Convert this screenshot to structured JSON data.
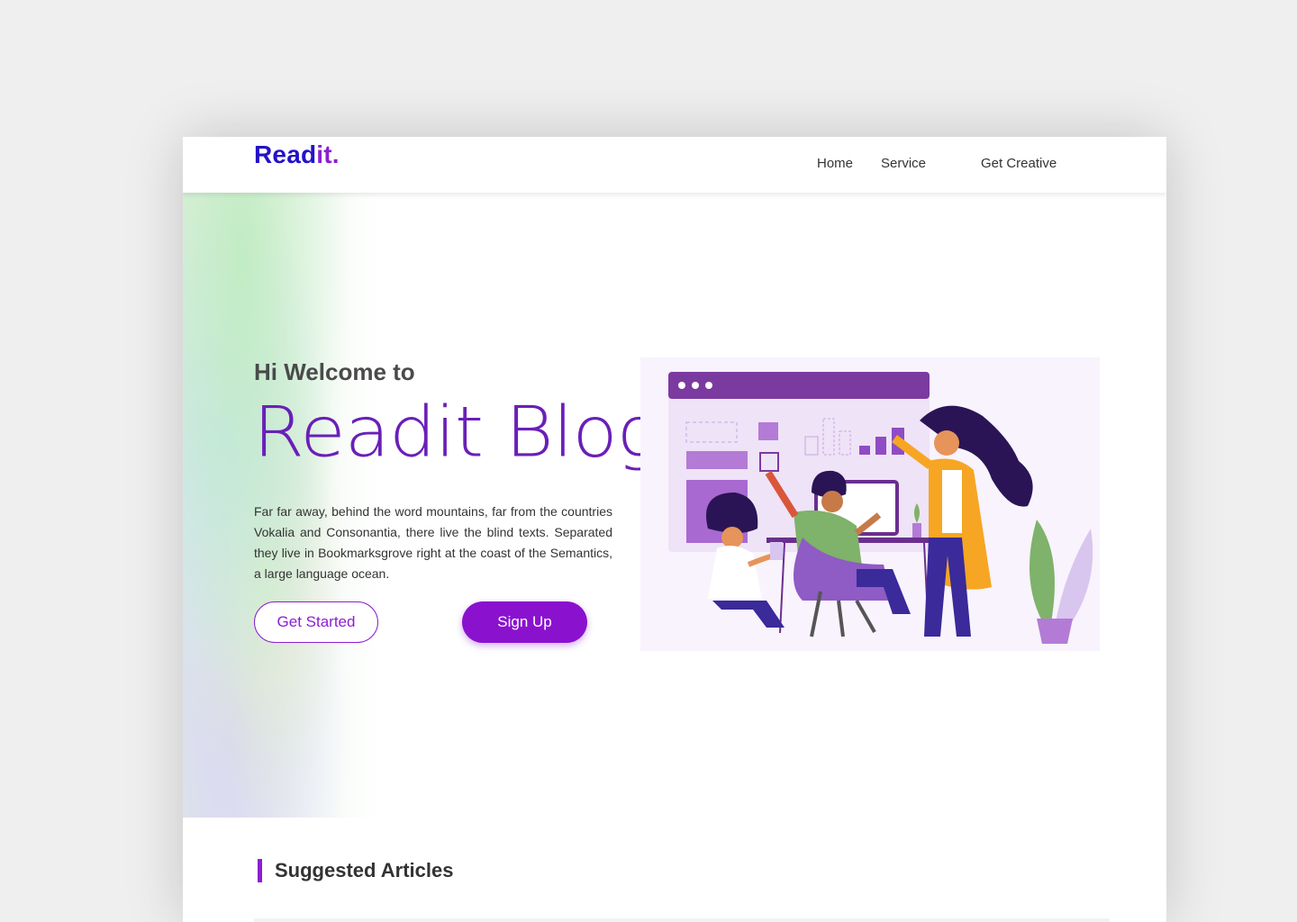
{
  "brand": {
    "name_main": "Read",
    "name_accent": "it.",
    "color_main": "#2411c9",
    "color_accent": "#8c1fd0"
  },
  "nav": {
    "items": [
      {
        "label": "Home"
      },
      {
        "label": "Service"
      },
      {
        "label": "Get Creative"
      }
    ]
  },
  "hero": {
    "greeting": "Hi Welcome to",
    "title": "Readit Blog",
    "description": "Far far away, behind the word mountains, far from the countries Vokalia and Consonantia, there live the blind texts. Separated they live in Bookmarksgrove right at the coast of the Semantics, a large language ocean.",
    "primary_button": "Get Started",
    "secondary_button": "Sign Up",
    "illustration_icon": "team-collaboration-illustration"
  },
  "suggested": {
    "title": "Suggested Articles"
  },
  "colors": {
    "accent": "#8a12cf",
    "text": "#333333"
  }
}
